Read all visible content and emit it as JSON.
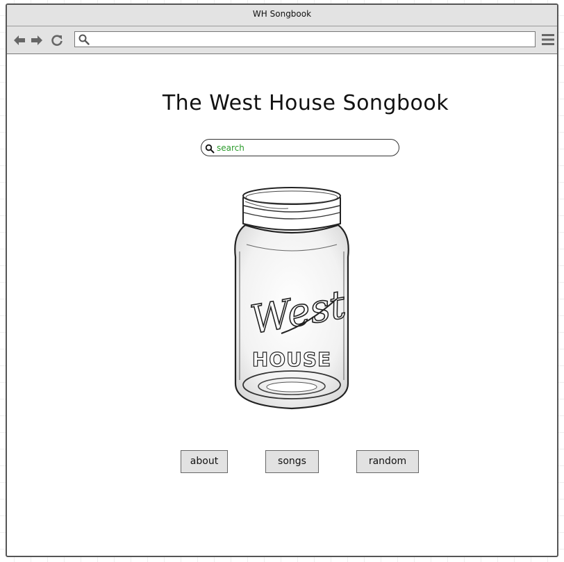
{
  "window": {
    "title": "WH Songbook"
  },
  "toolbar": {
    "url_value": "",
    "icons": [
      "back-arrow-icon",
      "forward-arrow-icon",
      "reload-icon",
      "search-icon",
      "hamburger-menu-icon"
    ]
  },
  "main": {
    "title": "The West House Songbook",
    "search_placeholder": "search",
    "logo": {
      "text_script": "West",
      "text_block": "HOUSE"
    },
    "buttons": [
      {
        "label": "about"
      },
      {
        "label": "songs"
      },
      {
        "label": "random"
      }
    ]
  },
  "colors": {
    "chrome": "#e3e3e3",
    "search_text": "#2a9a2a",
    "button_bg": "#e2e2e2"
  }
}
